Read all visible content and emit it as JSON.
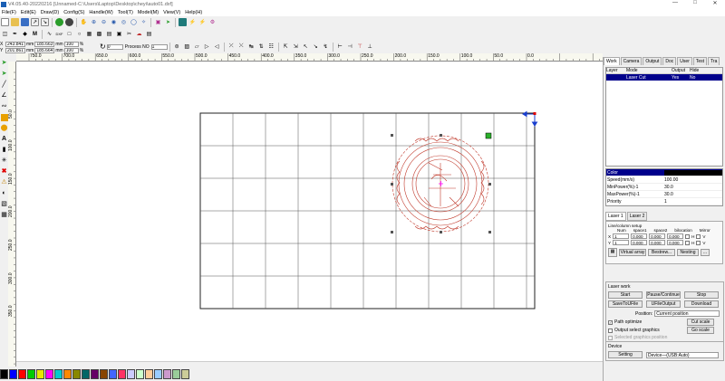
{
  "window": {
    "title": "V4.05.40-20220216  [Unnamed-C:\\Users\\Laptop\\Desktop\\cheyi\\auto01.dxf]"
  },
  "menu": [
    "File(F)",
    "Edit(E)",
    "Draw(D)",
    "Config(S)",
    "Handle(W)",
    "Tool(T)",
    "Model(M)",
    "View(V)",
    "Help(H)"
  ],
  "position": {
    "x": "243.841",
    "y": "201.861",
    "w": "185.663",
    "h": "185.664",
    "sx": "100",
    "sy": "100",
    "sx_unit": "%",
    "sy_unit": "%",
    "x_unit": "mm",
    "y_unit": "mm",
    "angle": "0",
    "process_label": "Process NO",
    "process_value": "1"
  },
  "rulers": {
    "top": [
      "750.0",
      "700.0",
      "650.0",
      "600.0",
      "550.0",
      "500.0",
      "450.0",
      "400.0",
      "350.0",
      "300.0",
      "250.0",
      "200.0",
      "150.0",
      "100.0",
      "50.0",
      "0.0"
    ],
    "left": [
      "50.0",
      "100.0",
      "150.0",
      "200.0",
      "250.0",
      "300.0",
      "350.0"
    ]
  },
  "tabs": [
    "Work",
    "Camera",
    "Output",
    "Doc",
    "User",
    "Test",
    "Tra"
  ],
  "layers": {
    "headers": [
      "Layer",
      "Mode",
      "Output",
      "Hide"
    ],
    "rows": [
      {
        "layer": "",
        "mode": "Laser Cut",
        "output": "Yes",
        "hide": "No"
      }
    ]
  },
  "props": [
    {
      "k": "Color",
      "v": ""
    },
    {
      "k": "Speed(mm/s)",
      "v": "100.00"
    },
    {
      "k": "MinPower(%)-1",
      "v": "30.0"
    },
    {
      "k": "MaxPower(%)-1",
      "v": "30.0"
    },
    {
      "k": "Priority",
      "v": "1"
    }
  ],
  "subtabs": [
    "Laser 1",
    "Laser 2"
  ],
  "array": {
    "title": "Line/column setup",
    "headers": [
      "Num",
      "space1",
      "space2",
      "bilocation",
      "Mirror"
    ],
    "rows": [
      {
        "axis": "X",
        "num": "1",
        "s1": "0.000",
        "s2": "0.000",
        "bi": "0.000",
        "m1": "H",
        "m2": "V"
      },
      {
        "axis": "Y",
        "num": "1",
        "s1": "0.000",
        "s2": "0.000",
        "bi": "0.000",
        "m1": "H",
        "m2": "V"
      }
    ],
    "buttons": [
      "Virtual array",
      "Bestrew...",
      "Nesting",
      "..."
    ]
  },
  "laserwork": {
    "title": "Laser work",
    "start": "Start",
    "pause": "Pause/Continue",
    "stop": "Stop",
    "save": "SaveToUFile",
    "ufile": "UFileOutput",
    "download": "Download",
    "position_label": "Position:",
    "position_value": "Current position",
    "path_opt": "Path optimize",
    "cut_scale": "Cut scale",
    "output_sel": "Output select graphics",
    "go_scale": "Go scale",
    "selected_pos": "Selected graphics position"
  },
  "device": {
    "title": "Device",
    "setting": "Setting",
    "value": "Device—(USB:Auto)"
  },
  "palette": [
    "#000000",
    "#0000ff",
    "#ff0000",
    "#00cc00",
    "#e8e800",
    "#ff00ff",
    "#00cccc",
    "#ff8800",
    "#888800",
    "#006666",
    "#660066",
    "#884400",
    "#4466ff",
    "#ff3366",
    "#ccccff",
    "#ccffcc",
    "#ffcc99",
    "#99ccff",
    "#cc99cc",
    "#99cc99",
    "#cccc99"
  ],
  "colors": {
    "selection": "#00008b",
    "shape": "#c0392b",
    "accent": "#1a5fb4"
  }
}
